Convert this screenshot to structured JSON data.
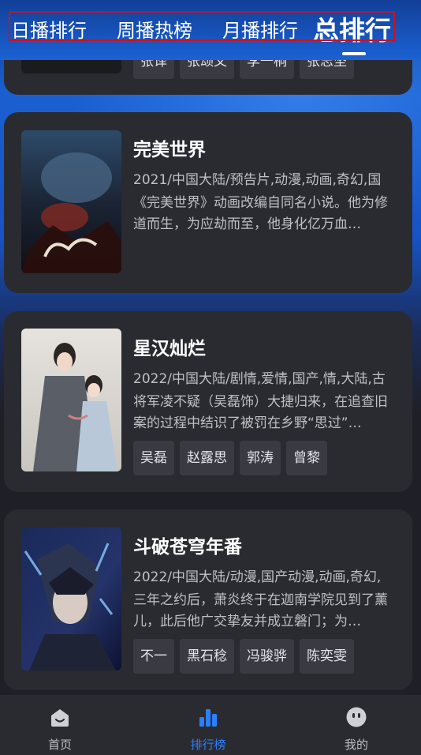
{
  "tabs": [
    {
      "label": "日播排行"
    },
    {
      "label": "周播热榜"
    },
    {
      "label": "月播排行"
    },
    {
      "label": "总排行"
    }
  ],
  "top_card": {
    "tags": [
      "张译",
      "张颂文",
      "李一桐",
      "张志坚"
    ]
  },
  "cards": [
    {
      "title": "完美世界",
      "meta": "2021/中国大陆/预告片,动漫,动画,奇幻,国",
      "desc": "《完美世界》动画改编自同名小说。他为修道而生，为应劫而至，他身化亿万血…",
      "tags": []
    },
    {
      "title": "星汉灿烂",
      "meta": "2022/中国大陆/剧情,爱情,国产,情,大陆,古",
      "desc": "将军凌不疑（吴磊饰）大捷归来，在追查旧案的过程中结识了被罚在乡野“思过”…",
      "tags": [
        "吴磊",
        "赵露思",
        "郭涛",
        "曾黎"
      ]
    },
    {
      "title": "斗破苍穹年番",
      "meta": "2022/中国大陆/动漫,国产动漫,动画,奇幻,",
      "desc": "三年之约后，萧炎终于在迦南学院见到了薰儿，此后他广交挚友并成立磐门；为…",
      "tags": [
        "不一",
        "黑石稔",
        "冯骏骅",
        "陈奕雯"
      ]
    }
  ],
  "bottom_nav": [
    {
      "label": "首页",
      "icon": "home-icon"
    },
    {
      "label": "排行榜",
      "icon": "bar-chart-icon",
      "active": true
    },
    {
      "label": "我的",
      "icon": "profile-icon"
    }
  ],
  "colors": {
    "accent": "#2a7fff",
    "card_bg": "#2a2b31",
    "tag_bg": "#3a3b42",
    "highlight_box": "#cc1122"
  }
}
